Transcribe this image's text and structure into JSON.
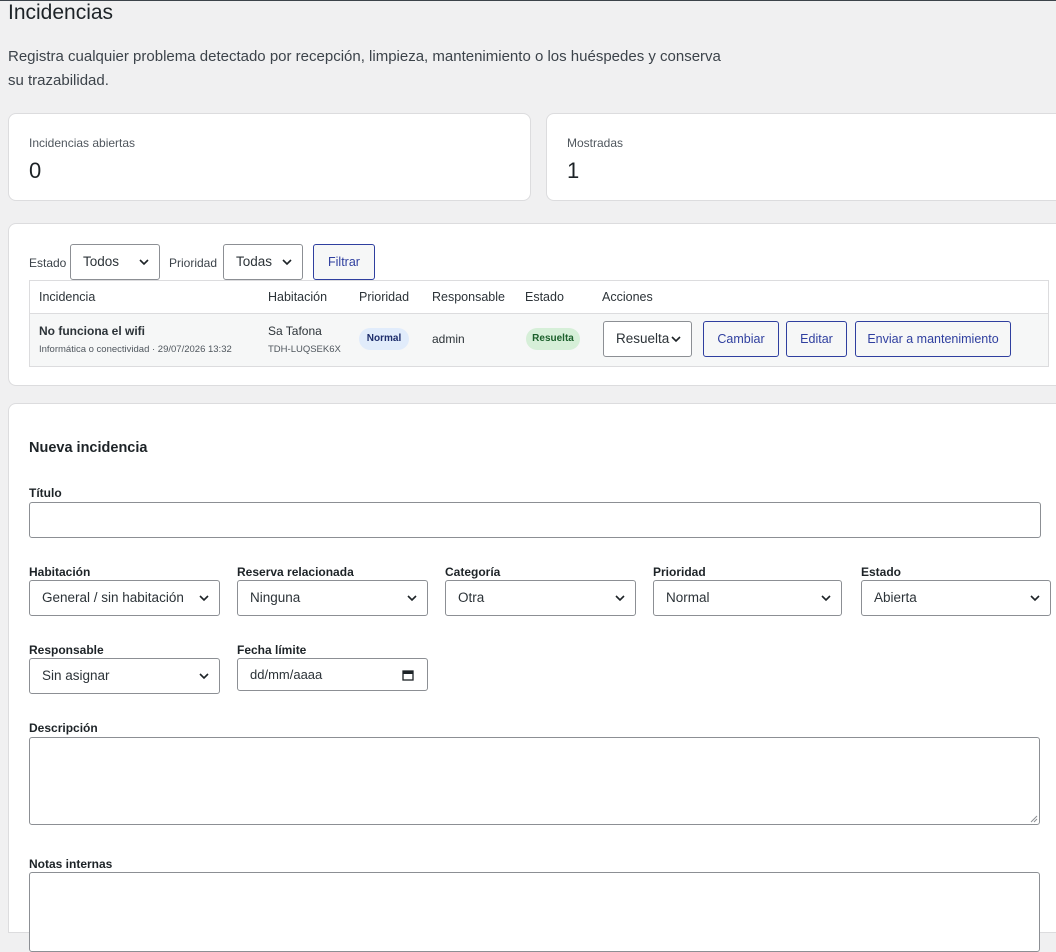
{
  "page": {
    "title": "Incidencias",
    "description": "Registra cualquier problema detectado por recepción, limpieza, mantenimiento o los huéspedes y conserva su trazabilidad."
  },
  "stats": [
    {
      "label": "Incidencias abiertas",
      "value": "0"
    },
    {
      "label": "Mostradas",
      "value": "1"
    }
  ],
  "filters": {
    "estado_label": "Estado",
    "estado_value": "Todos",
    "prioridad_label": "Prioridad",
    "prioridad_value": "Todas",
    "filter_button": "Filtrar"
  },
  "table": {
    "headers": [
      "Incidencia",
      "Habitación",
      "Prioridad",
      "Responsable",
      "Estado",
      "Acciones"
    ],
    "rows": [
      {
        "title": "No funciona el wifi",
        "subtitle": "Informática o conectividad · 29/07/2026 13:32",
        "room": "Sa Tafona",
        "room_code": "TDH-LUQSEK6X",
        "priority": "Normal",
        "responsible": "admin",
        "status": "Resuelta",
        "status_select": "Resuelta",
        "btn_change": "Cambiar",
        "btn_edit": "Editar",
        "btn_maintenance": "Enviar a mantenimiento"
      }
    ]
  },
  "form": {
    "title": "Nueva incidencia",
    "titulo_label": "Título",
    "titulo_value": "",
    "habitacion_label": "Habitación",
    "habitacion_value": "General / sin habitación",
    "reserva_label": "Reserva relacionada",
    "reserva_value": "Ninguna",
    "categoria_label": "Categoría",
    "categoria_value": "Otra",
    "prioridad_label": "Prioridad",
    "prioridad_value": "Normal",
    "estado_label": "Estado",
    "estado_value": "Abierta",
    "responsable_label": "Responsable",
    "responsable_value": "Sin asignar",
    "fecha_label": "Fecha límite",
    "fecha_placeholder": "dd/mm/aaaa",
    "descripcion_label": "Descripción",
    "notas_label": "Notas internas"
  },
  "colors": {
    "accent": "#2f3f9f",
    "badge_normal_bg": "#e1ecfb",
    "badge_resuelta_bg": "#d6efd8",
    "badge_resuelta_fg": "#1a5f2a"
  }
}
